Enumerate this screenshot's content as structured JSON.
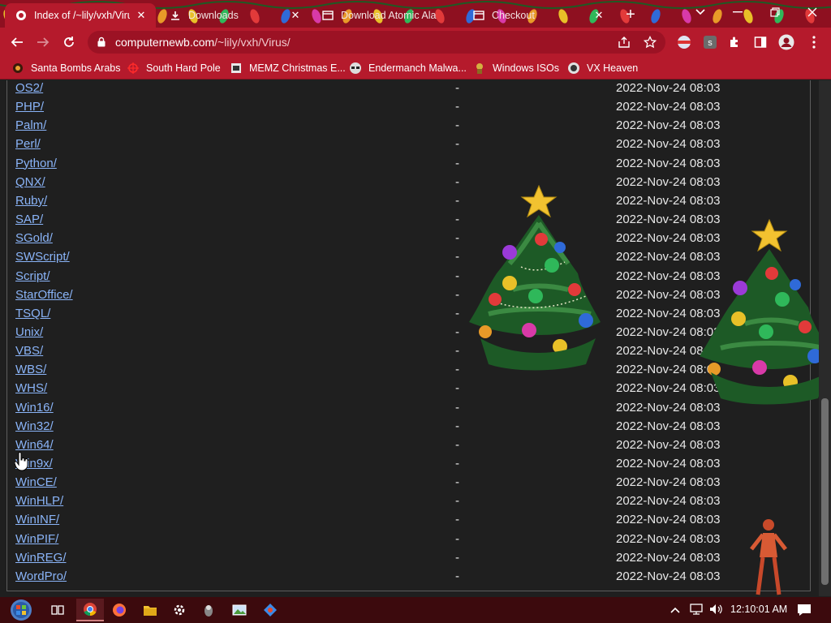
{
  "browser": {
    "tabs": [
      {
        "title": "Index of /~lily/vxh/Virus",
        "active": true,
        "icon": "page-icon"
      },
      {
        "title": "Downloads",
        "active": false,
        "icon": "download-icon"
      },
      {
        "title": "Download Atomic Alarm",
        "active": false,
        "icon": "page-icon"
      },
      {
        "title": "Checkout",
        "active": false,
        "icon": "page-icon"
      }
    ],
    "url_host": "computernewb.com",
    "url_path": "/~lily/vxh/Virus/",
    "theme_color": "#b51a2c"
  },
  "bookmarks": [
    {
      "label": "Santa Bombs Arabs",
      "icon": "bookmark-icon"
    },
    {
      "label": "South Hard Pole",
      "icon": "bookmark-icon"
    },
    {
      "label": "MEMZ Christmas E...",
      "icon": "bookmark-icon"
    },
    {
      "label": "Endermanch Malwa...",
      "icon": "bookmark-icon"
    },
    {
      "label": "Windows ISOs",
      "icon": "bookmark-icon"
    },
    {
      "label": "VX Heaven",
      "icon": "bookmark-icon"
    }
  ],
  "listing": [
    {
      "name": "OS2/",
      "size": "-",
      "modified": "2022-Nov-24 08:03"
    },
    {
      "name": "PHP/",
      "size": "-",
      "modified": "2022-Nov-24 08:03"
    },
    {
      "name": "Palm/",
      "size": "-",
      "modified": "2022-Nov-24 08:03"
    },
    {
      "name": "Perl/",
      "size": "-",
      "modified": "2022-Nov-24 08:03"
    },
    {
      "name": "Python/",
      "size": "-",
      "modified": "2022-Nov-24 08:03"
    },
    {
      "name": "QNX/",
      "size": "-",
      "modified": "2022-Nov-24 08:03"
    },
    {
      "name": "Ruby/",
      "size": "-",
      "modified": "2022-Nov-24 08:03"
    },
    {
      "name": "SAP/",
      "size": "-",
      "modified": "2022-Nov-24 08:03"
    },
    {
      "name": "SGold/",
      "size": "-",
      "modified": "2022-Nov-24 08:03"
    },
    {
      "name": "SWScript/",
      "size": "-",
      "modified": "2022-Nov-24 08:03"
    },
    {
      "name": "Script/",
      "size": "-",
      "modified": "2022-Nov-24 08:03"
    },
    {
      "name": "StarOffice/",
      "size": "-",
      "modified": "2022-Nov-24 08:03"
    },
    {
      "name": "TSQL/",
      "size": "-",
      "modified": "2022-Nov-24 08:03"
    },
    {
      "name": "Unix/",
      "size": "-",
      "modified": "2022-Nov-24 08:03"
    },
    {
      "name": "VBS/",
      "size": "-",
      "modified": "2022-Nov-24 08:03"
    },
    {
      "name": "WBS/",
      "size": "-",
      "modified": "2022-Nov-24 08:03"
    },
    {
      "name": "WHS/",
      "size": "-",
      "modified": "2022-Nov-24 08:03"
    },
    {
      "name": "Win16/",
      "size": "-",
      "modified": "2022-Nov-24 08:03"
    },
    {
      "name": "Win32/",
      "size": "-",
      "modified": "2022-Nov-24 08:03"
    },
    {
      "name": "Win64/",
      "size": "-",
      "modified": "2022-Nov-24 08:03"
    },
    {
      "name": "Win9x/",
      "size": "-",
      "modified": "2022-Nov-24 08:03"
    },
    {
      "name": "WinCE/",
      "size": "-",
      "modified": "2022-Nov-24 08:03"
    },
    {
      "name": "WinHLP/",
      "size": "-",
      "modified": "2022-Nov-24 08:03"
    },
    {
      "name": "WinINF/",
      "size": "-",
      "modified": "2022-Nov-24 08:03"
    },
    {
      "name": "WinPIF/",
      "size": "-",
      "modified": "2022-Nov-24 08:03"
    },
    {
      "name": "WinREG/",
      "size": "-",
      "modified": "2022-Nov-24 08:03"
    },
    {
      "name": "WordPro/",
      "size": "-",
      "modified": "2022-Nov-24 08:03"
    }
  ],
  "taskbar": {
    "clock": "12:10:01 AM",
    "apps": [
      "start-orb-icon",
      "task-view-icon",
      "chrome-icon",
      "firefox-icon",
      "file-explorer-icon",
      "settings-icon",
      "malware-app-icon",
      "image-viewer-icon",
      "app-icon"
    ]
  },
  "colors": {
    "link": "#8ab4f8",
    "page_bg": "#1f1f1f",
    "tab_strip": "#8e1020"
  }
}
